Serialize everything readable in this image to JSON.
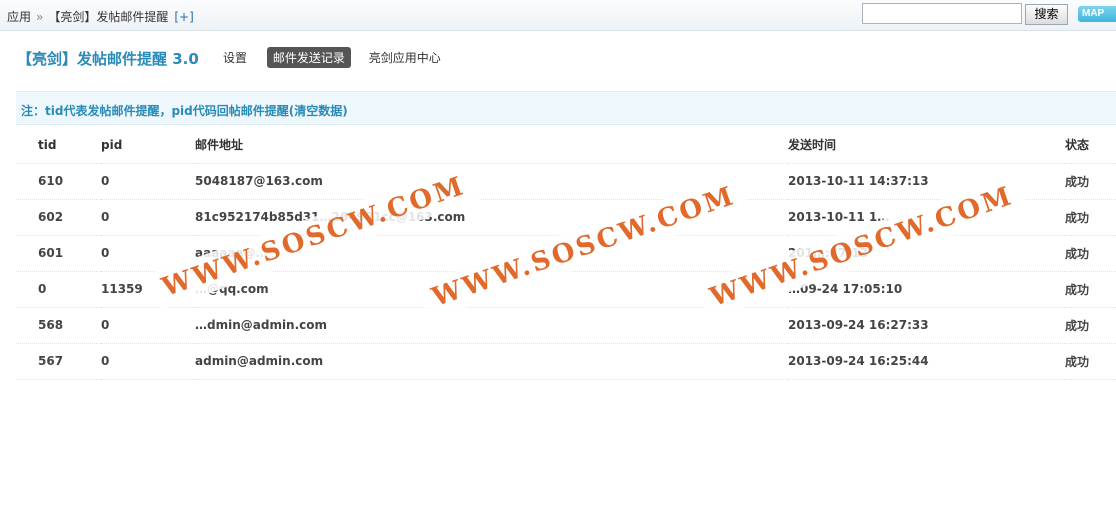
{
  "breadcrumb": {
    "root": "应用",
    "separator": "»",
    "current": "【亮剑】发帖邮件提醒",
    "add": "[+]"
  },
  "search": {
    "value": "",
    "button_label": "搜索"
  },
  "map_label": "MAP",
  "app": {
    "title": "【亮剑】发帖邮件提醒 3.0",
    "nav": [
      {
        "label": "设置",
        "active": false
      },
      {
        "label": "邮件发送记录",
        "active": true
      },
      {
        "label": "亮剑应用中心",
        "active": false
      }
    ]
  },
  "notice": "注：tid代表发帖邮件提醒，pid代码回帖邮件提醒(清空数据)",
  "table": {
    "headers": [
      "tid",
      "pid",
      "邮件地址",
      "发送时间",
      "状态"
    ],
    "rows": [
      [
        "610",
        "0",
        "5048187@163.com",
        "2013-10-11 14:37:13",
        "成功"
      ],
      [
        "602",
        "0",
        "81c952174b85d31…264901cc@163.com",
        "2013-10-11 1…",
        "成功"
      ],
      [
        "601",
        "0",
        "aaaaaa@…",
        "201…:37:13",
        "成功"
      ],
      [
        "0",
        "11359",
        "…@qq.com",
        "…09-24 17:05:10",
        "成功"
      ],
      [
        "568",
        "0",
        "…dmin@admin.com",
        "2013-09-24 16:27:33",
        "成功"
      ],
      [
        "567",
        "0",
        "admin@admin.com",
        "2013-09-24 16:25:44",
        "成功"
      ]
    ]
  },
  "watermark": "WWW.SOSCW.COM"
}
